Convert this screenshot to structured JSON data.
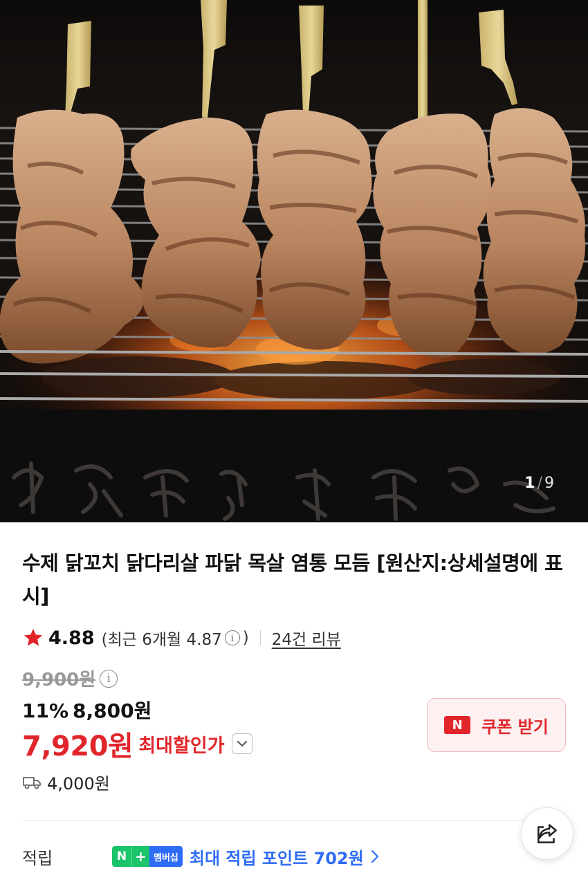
{
  "hero": {
    "image_alt": "grilled chicken skewers",
    "counter_current": "1",
    "counter_sep": "/",
    "counter_total": "9"
  },
  "product": {
    "title": "수제 닭꼬치 닭다리살 파닭 목살 염통 모듬 [원산지:상세설명에 표시]",
    "rating": "4.88",
    "recent_rating_prefix": "(최근 6개월 4.87",
    "recent_rating_suffix": ")",
    "review_count": "24건 리뷰",
    "original_price": "9,900원",
    "discount_rate": "11%",
    "sale_price": "8,800원",
    "max_discount_price": "7,920원",
    "max_discount_label": "최대할인가",
    "coupon_badge": "N",
    "coupon_label": "쿠폰 받기",
    "shipping_fee": "4,000원",
    "points_label": "적립",
    "membership_n": "N",
    "membership_plus": "+",
    "membership_label": "멤버십",
    "points_text": "최대 적립 포인트 702원"
  },
  "icons": {
    "star": "star-icon",
    "info": "info-icon",
    "chevron": "chevron-down-icon",
    "truck": "truck-icon",
    "share": "share-icon",
    "arrow": "chevron-right-icon"
  },
  "colors": {
    "accent_red": "#e1262b",
    "npay_green": "#19c46a",
    "membership_blue": "#2f6cf5"
  }
}
